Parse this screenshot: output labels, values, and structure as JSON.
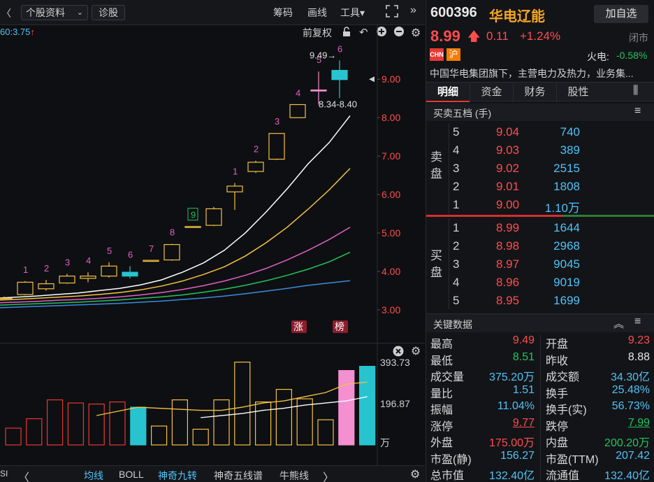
{
  "toolbar": {
    "select_label": "个股资料",
    "diagnose": "诊股",
    "chips": "筹码",
    "draw": "画线",
    "tools": "工具▾",
    "ma_label": "60:3.75",
    "adjust": "前复权"
  },
  "chart_data": {
    "type": "candlestick",
    "y_ticks": [
      "9.00",
      "8.00",
      "7.00",
      "6.00",
      "5.00",
      "4.00",
      "3.00"
    ],
    "y_range": [
      2.8,
      9.75
    ],
    "high_label": "9.49→",
    "range_label": "8.34-8.40",
    "candles": [
      {
        "o": 3.3,
        "c": 3.3,
        "h": 3.35,
        "l": 3.25,
        "up": true
      },
      {
        "o": 3.4,
        "c": 3.72,
        "h": 3.75,
        "l": 3.38,
        "up": true,
        "seq": "1"
      },
      {
        "o": 3.55,
        "c": 3.68,
        "h": 3.78,
        "l": 3.5,
        "up": true,
        "seq": "2"
      },
      {
        "o": 3.7,
        "c": 3.88,
        "h": 3.94,
        "l": 3.68,
        "up": true,
        "seq": "3"
      },
      {
        "o": 3.82,
        "c": 3.88,
        "h": 3.98,
        "l": 3.72,
        "up": true,
        "seq": "4"
      },
      {
        "o": 3.88,
        "c": 4.14,
        "h": 4.24,
        "l": 3.84,
        "up": true,
        "seq": "5"
      },
      {
        "o": 3.98,
        "c": 3.88,
        "h": 4.14,
        "l": 3.82,
        "up": false,
        "seq": "6"
      },
      {
        "o": 4.29,
        "c": 4.29,
        "h": 4.29,
        "l": 4.29,
        "up": true,
        "seq": "7"
      },
      {
        "o": 4.3,
        "c": 4.7,
        "h": 4.72,
        "l": 4.28,
        "up": true,
        "seq": "8"
      },
      {
        "o": 5.17,
        "c": 5.17,
        "h": 5.17,
        "l": 5.17,
        "up": true,
        "seq": "9"
      },
      {
        "o": 5.2,
        "c": 5.63,
        "h": 5.68,
        "l": 5.18,
        "up": true
      },
      {
        "o": 6.07,
        "c": 6.22,
        "h": 6.3,
        "l": 5.6,
        "up": true,
        "seq": "1"
      },
      {
        "o": 6.6,
        "c": 6.84,
        "h": 6.88,
        "l": 6.56,
        "up": true,
        "seq": "2"
      },
      {
        "o": 6.92,
        "c": 7.59,
        "h": 7.6,
        "l": 6.9,
        "up": true,
        "seq": "3"
      },
      {
        "o": 8.0,
        "c": 8.34,
        "h": 8.34,
        "l": 8.0,
        "up": true,
        "seq": "4"
      },
      {
        "o": 8.72,
        "c": 8.72,
        "h": 9.2,
        "l": 8.34,
        "up": true,
        "pink": true,
        "seq": "5"
      },
      {
        "o": 9.23,
        "c": 8.99,
        "h": 9.49,
        "l": 8.51,
        "up": false,
        "seq": "6"
      }
    ],
    "ma_lines": [
      {
        "color": "#ffffff",
        "values": [
          3.3,
          3.33,
          3.36,
          3.4,
          3.44,
          3.5,
          3.56,
          3.65,
          3.78,
          3.98,
          4.22,
          4.55,
          5.0,
          5.55,
          6.15,
          6.8,
          7.35,
          8.05
        ]
      },
      {
        "color": "#f5c242",
        "values": [
          3.25,
          3.27,
          3.3,
          3.33,
          3.36,
          3.4,
          3.45,
          3.52,
          3.62,
          3.75,
          3.92,
          4.12,
          4.4,
          4.75,
          5.15,
          5.62,
          6.12,
          6.68
        ]
      },
      {
        "color": "#e25fc6",
        "values": [
          3.18,
          3.2,
          3.22,
          3.25,
          3.27,
          3.3,
          3.34,
          3.39,
          3.45,
          3.53,
          3.63,
          3.75,
          3.9,
          4.08,
          4.3,
          4.55,
          4.83,
          5.15
        ]
      },
      {
        "color": "#22c55e",
        "values": [
          3.12,
          3.14,
          3.16,
          3.18,
          3.2,
          3.23,
          3.26,
          3.3,
          3.34,
          3.39,
          3.46,
          3.54,
          3.64,
          3.76,
          3.9,
          4.06,
          4.25,
          4.5
        ]
      },
      {
        "color": "#3b8be0",
        "values": [
          3.05,
          3.07,
          3.09,
          3.11,
          3.13,
          3.15,
          3.17,
          3.2,
          3.23,
          3.27,
          3.31,
          3.36,
          3.42,
          3.49,
          3.56,
          3.64,
          3.7,
          3.76
        ]
      }
    ],
    "badges": [
      "涨",
      "榜"
    ],
    "volume": {
      "ticks": [
        "393.73",
        "196.87",
        "万"
      ],
      "max": 393.73,
      "bars": [
        {
          "v": 80,
          "c": "up"
        },
        {
          "v": 125,
          "c": "up"
        },
        {
          "v": 215,
          "c": "up"
        },
        {
          "v": 200,
          "c": "up"
        },
        {
          "v": 195,
          "c": "up"
        },
        {
          "v": 205,
          "c": "up"
        },
        {
          "v": 180,
          "c": "cyan"
        },
        {
          "v": 90,
          "c": "up"
        },
        {
          "v": 215,
          "c": "up"
        },
        {
          "v": 75,
          "c": "up"
        },
        {
          "v": 215,
          "c": "up"
        },
        {
          "v": 395,
          "c": "up"
        },
        {
          "v": 205,
          "c": "up"
        },
        {
          "v": 265,
          "c": "up"
        },
        {
          "v": 220,
          "c": "up"
        },
        {
          "v": 120,
          "c": "up"
        },
        {
          "v": 355,
          "c": "pink"
        },
        {
          "v": 375,
          "c": "cyan"
        }
      ],
      "ma_a": [
        null,
        null,
        null,
        null,
        140,
        160,
        180,
        175,
        170,
        165,
        165,
        180,
        200,
        210,
        230,
        250,
        290,
        300
      ],
      "ma_b": [
        null,
        null,
        null,
        null,
        null,
        null,
        null,
        null,
        null,
        130,
        140,
        150,
        165,
        175,
        190,
        200,
        210,
        230
      ]
    }
  },
  "bottom_tabs": [
    "均线",
    "BOLL",
    "神奇九转",
    "神奇五线谱",
    "牛熊线"
  ],
  "stock": {
    "code": "600396",
    "name": "华电辽能",
    "add_watch": "加自选",
    "price": "8.99",
    "change": "0.11",
    "change_pct": "+1.24%",
    "status": "闭市",
    "tags": [
      "CHN",
      "沪"
    ],
    "sector": "火电:",
    "sector_change": "-0.58%",
    "desc": "中国华电集团旗下，主营电力及热力，业务集..."
  },
  "tabs": [
    "明细",
    "资金",
    "财务",
    "股性"
  ],
  "orderbook": {
    "title": "买卖五档 (手)",
    "sell_label": "卖盘",
    "buy_label": "买盘",
    "sells": [
      {
        "lvl": "5",
        "price": "9.04",
        "vol": "740"
      },
      {
        "lvl": "4",
        "price": "9.03",
        "vol": "389"
      },
      {
        "lvl": "3",
        "price": "9.02",
        "vol": "2515"
      },
      {
        "lvl": "2",
        "price": "9.01",
        "vol": "1808"
      },
      {
        "lvl": "1",
        "price": "9.00",
        "vol": "1.10万"
      }
    ],
    "buys": [
      {
        "lvl": "1",
        "price": "8.99",
        "vol": "1644"
      },
      {
        "lvl": "2",
        "price": "8.98",
        "vol": "2968"
      },
      {
        "lvl": "3",
        "price": "8.97",
        "vol": "9045"
      },
      {
        "lvl": "4",
        "price": "8.96",
        "vol": "9019"
      },
      {
        "lvl": "5",
        "price": "8.95",
        "vol": "1699"
      }
    ]
  },
  "key_data": {
    "title": "关键数据",
    "rows": [
      [
        "最高",
        "9.49",
        "up",
        "开盘",
        "9.23",
        "up"
      ],
      [
        "最低",
        "8.51",
        "dn",
        "昨收",
        "8.88",
        "wh"
      ],
      [
        "成交量",
        "375.20万",
        "cy",
        "成交额",
        "34.30亿",
        "cy"
      ],
      [
        "量比",
        "1.51",
        "cy",
        "换手",
        "25.48%",
        "cy"
      ],
      [
        "振幅",
        "11.04%",
        "cy",
        "换手(实)",
        "56.73%",
        "cy"
      ],
      [
        "涨停",
        "9.77",
        "up",
        "跌停",
        "7.99",
        "dn"
      ],
      [
        "外盘",
        "175.00万",
        "up",
        "内盘",
        "200.20万",
        "dn"
      ],
      [
        "市盈(静)",
        "156.27",
        "cy",
        "市盈(TTM)",
        "207.42",
        "cy"
      ],
      [
        "总市值",
        "132.40亿",
        "cy",
        "流通值",
        "132.40亿",
        "cy"
      ]
    ]
  }
}
